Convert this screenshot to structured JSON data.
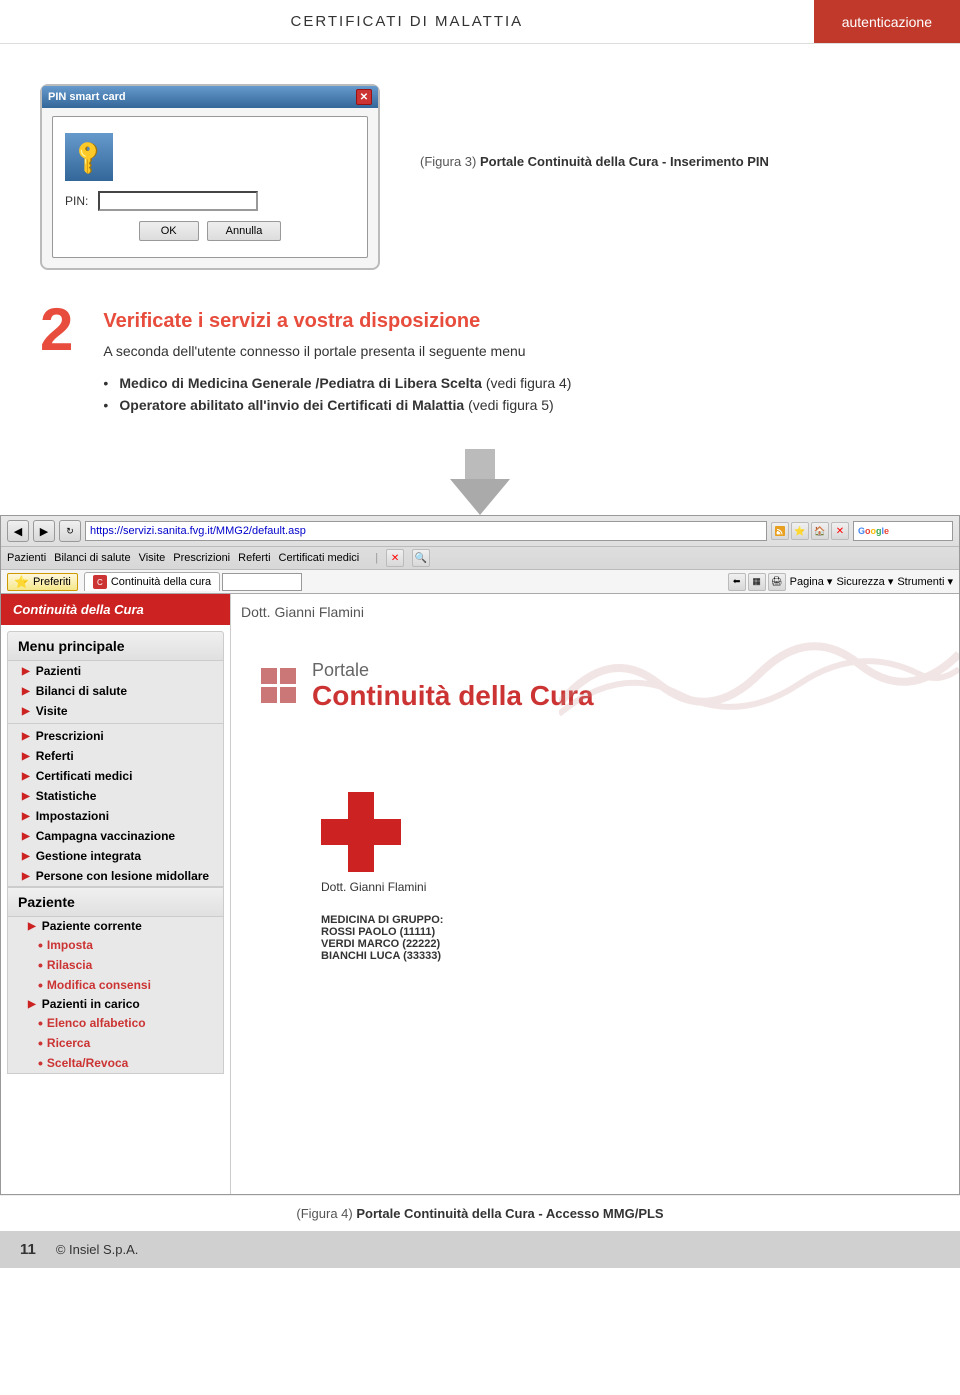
{
  "header": {
    "title": "CERTIFICATI DI MALATTIA",
    "auth_label": "autenticazione"
  },
  "dialog": {
    "title": "PIN smart card",
    "close": "✕",
    "pin_label": "PIN:",
    "ok_label": "OK",
    "cancel_label": "Annulla"
  },
  "figure3_caption": "(Figura 3)",
  "figure3_desc": "Portale Continuità della Cura - Inserimento PIN",
  "section2": {
    "number": "2",
    "heading": "Verificate i servizi a vostra disposizione",
    "desc": "A seconda dell'utente connesso il portale presenta il seguente menu",
    "bullets": [
      {
        "text_plain": "Medico di Medicina Generale /Pediatra di Libera Scelta",
        "text_suffix": "(vedi figura 4)"
      },
      {
        "text_plain": "Operatore abilitato all'invio dei Certificati di Malattia",
        "text_suffix": "(vedi figura 5)"
      }
    ]
  },
  "browser": {
    "url": "https://servizi.sanita.fvg.it/MMG2/default.asp",
    "menu_items": [
      "Pazienti",
      "Bilanci di salute",
      "Visite",
      "Prescrizioni",
      "Referti",
      "Certificati medici",
      "Statistiche",
      "Impostazioni",
      "Campagna vaccinazione",
      "Gestione integrata",
      "Persone con lesione midollare"
    ],
    "favorites_label": "Preferiti",
    "tab_label": "Continuità della cura",
    "right_menu": [
      "Pagina ▾",
      "Sicurezza ▾",
      "Strumenti ▾"
    ],
    "sidebar_header": "Continuità della Cura",
    "doctor_name_top": "Dott. Gianni Flamini",
    "menu_principale_title": "Menu principale",
    "paziente_title": "Paziente",
    "paziente_items": [
      "Paziente corrente",
      "Pazienti in carico"
    ],
    "paziente_sub_items": {
      "Paziente corrente": [
        "Imposta",
        "Rilascia",
        "Modifica consensi"
      ],
      "Pazienti in carico": [
        "Elenco alfabetico",
        "Ricerca",
        "Scelta/Revoca"
      ]
    },
    "portale_word": "Portale",
    "continuita_text": "Continuità della Cura",
    "doctor_name_bottom": "Dott. Gianni Flamini",
    "medicina_group": "MEDICINA DI GRUPPO:",
    "medicina_group_items": [
      "ROSSI PAOLO (11111)",
      "VERDI MARCO (22222)",
      "BIANCHI LUCA (33333)"
    ]
  },
  "figure4_caption": "(Figura 4)",
  "figure4_desc": "Portale Continuità della Cura - Accesso MMG/PLS",
  "footer": {
    "page_number": "11",
    "copyright": "© Insiel S.p.A."
  }
}
